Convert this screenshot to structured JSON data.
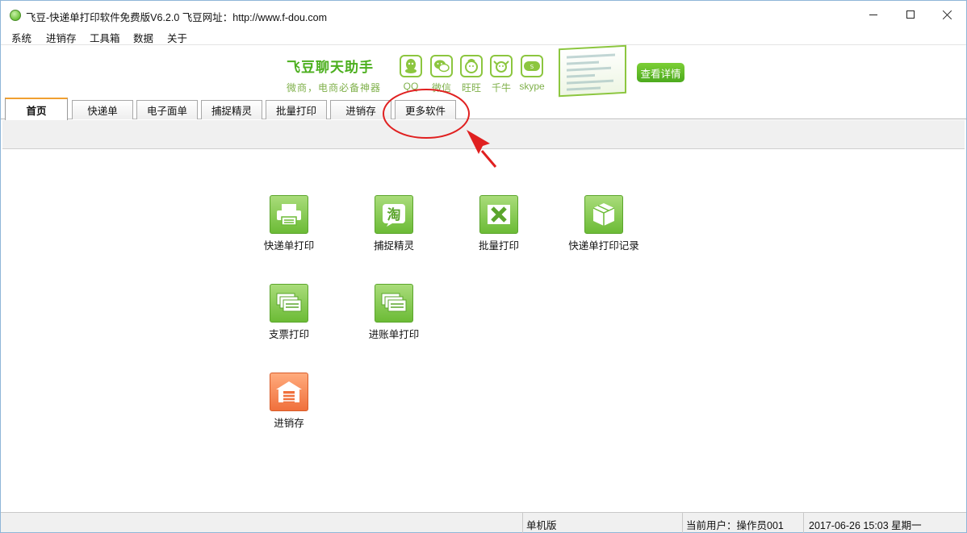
{
  "window": {
    "title": "飞豆-快递单打印软件免费版V6.2.0   飞豆网址：http://www.f-dou.com"
  },
  "menu": [
    "系统",
    "进销存",
    "工具箱",
    "数据",
    "关于"
  ],
  "banner": {
    "title": "飞豆聊天助手",
    "subtitle": "微商，电商必备神器",
    "apps": [
      {
        "label": "QQ",
        "icon": "qq-icon"
      },
      {
        "label": "微信",
        "icon": "wechat-icon"
      },
      {
        "label": "旺旺",
        "icon": "wangwang-icon"
      },
      {
        "label": "千牛",
        "icon": "qianniu-icon"
      },
      {
        "label": "skype",
        "icon": "skype-icon"
      }
    ],
    "detail_button": "查看详情"
  },
  "tabs": [
    "首页",
    "快递单",
    "电子面单",
    "捕捉精灵",
    "批量打印",
    "进销存",
    "更多软件"
  ],
  "active_tab": 0,
  "tiles": [
    {
      "label": "快递单打印",
      "icon": "printer-icon"
    },
    {
      "label": "捕捉精灵",
      "icon": "taobao-icon"
    },
    {
      "label": "批量打印",
      "icon": "excel-icon"
    },
    {
      "label": "快递单打印记录",
      "icon": "package-icon"
    },
    {
      "label": "支票打印",
      "icon": "checks-icon"
    },
    {
      "label": "进账单打印",
      "icon": "deposit-slip-icon"
    },
    {
      "label": "进销存",
      "icon": "warehouse-icon"
    }
  ],
  "status": {
    "edition": "单机版",
    "user": "当前用户：操作员001",
    "datetime": "2017-06-26 15:03 星期一"
  },
  "colors": {
    "brand_green": "#4caf1e",
    "tile_green": "#6cbb36",
    "tile_orange": "#f0703c",
    "annotation_red": "#e02020"
  }
}
